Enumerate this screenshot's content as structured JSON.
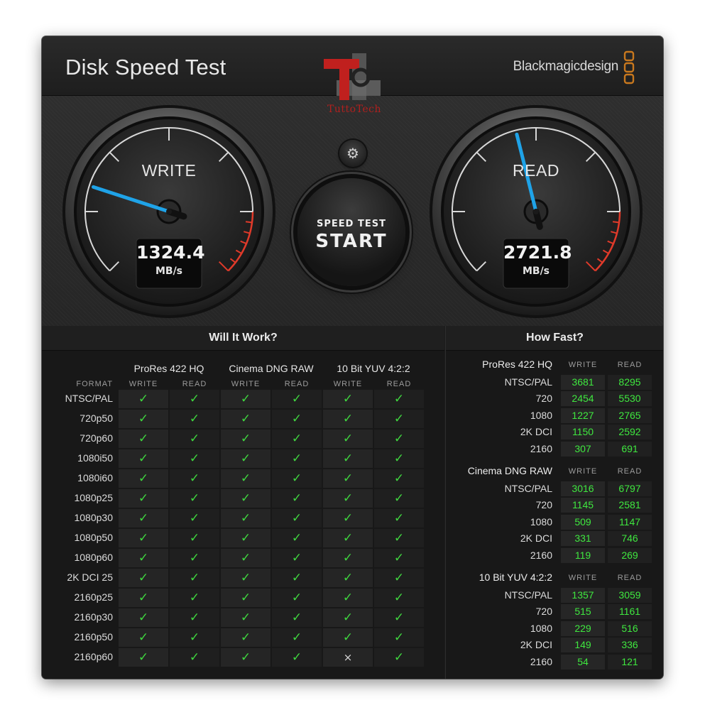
{
  "window": {
    "title": "Disk Speed Test",
    "brand": "Blackmagicdesign",
    "close_label": "×"
  },
  "watermark": {
    "text": "TuttoTech"
  },
  "gauges": {
    "write": {
      "label": "WRITE",
      "value": "1324.4",
      "unit": "MB/s"
    },
    "read": {
      "label": "READ",
      "value": "2721.8",
      "unit": "MB/s"
    }
  },
  "controls": {
    "settings_icon": "gear-icon",
    "settings_glyph": "⚙",
    "start_line1": "SPEED TEST",
    "start_line2": "START"
  },
  "will_it_work": {
    "title": "Will It Work?",
    "format_label": "FORMAT",
    "codecs": [
      {
        "name": "ProRes 422 HQ",
        "write": "WRITE",
        "read": "READ"
      },
      {
        "name": "Cinema DNG RAW",
        "write": "WRITE",
        "read": "READ"
      },
      {
        "name": "10 Bit YUV 4:2:2",
        "write": "WRITE",
        "read": "READ"
      }
    ],
    "formats": [
      "NTSC/PAL",
      "720p50",
      "720p60",
      "1080i50",
      "1080i60",
      "1080p25",
      "1080p30",
      "1080p50",
      "1080p60",
      "2K DCI 25",
      "2160p25",
      "2160p30",
      "2160p50",
      "2160p60"
    ],
    "results": [
      [
        1,
        1,
        1,
        1,
        1,
        1
      ],
      [
        1,
        1,
        1,
        1,
        1,
        1
      ],
      [
        1,
        1,
        1,
        1,
        1,
        1
      ],
      [
        1,
        1,
        1,
        1,
        1,
        1
      ],
      [
        1,
        1,
        1,
        1,
        1,
        1
      ],
      [
        1,
        1,
        1,
        1,
        1,
        1
      ],
      [
        1,
        1,
        1,
        1,
        1,
        1
      ],
      [
        1,
        1,
        1,
        1,
        1,
        1
      ],
      [
        1,
        1,
        1,
        1,
        1,
        1
      ],
      [
        1,
        1,
        1,
        1,
        1,
        1
      ],
      [
        1,
        1,
        1,
        1,
        1,
        1
      ],
      [
        1,
        1,
        1,
        1,
        1,
        1
      ],
      [
        1,
        1,
        1,
        1,
        1,
        1
      ],
      [
        1,
        1,
        1,
        1,
        0,
        1
      ]
    ],
    "ok_glyph": "✓",
    "fail_glyph": "×"
  },
  "how_fast": {
    "title": "How Fast?",
    "groups": [
      {
        "name": "ProRes 422 HQ",
        "write": "WRITE",
        "read": "READ",
        "rows": [
          {
            "format": "NTSC/PAL",
            "write": "3681",
            "read": "8295"
          },
          {
            "format": "720",
            "write": "2454",
            "read": "5530"
          },
          {
            "format": "1080",
            "write": "1227",
            "read": "2765"
          },
          {
            "format": "2K DCI",
            "write": "1150",
            "read": "2592"
          },
          {
            "format": "2160",
            "write": "307",
            "read": "691"
          }
        ]
      },
      {
        "name": "Cinema DNG RAW",
        "write": "WRITE",
        "read": "READ",
        "rows": [
          {
            "format": "NTSC/PAL",
            "write": "3016",
            "read": "6797"
          },
          {
            "format": "720",
            "write": "1145",
            "read": "2581"
          },
          {
            "format": "1080",
            "write": "509",
            "read": "1147"
          },
          {
            "format": "2K DCI",
            "write": "331",
            "read": "746"
          },
          {
            "format": "2160",
            "write": "119",
            "read": "269"
          }
        ]
      },
      {
        "name": "10 Bit YUV 4:2:2",
        "write": "WRITE",
        "read": "READ",
        "rows": [
          {
            "format": "NTSC/PAL",
            "write": "1357",
            "read": "3059"
          },
          {
            "format": "720",
            "write": "515",
            "read": "1161"
          },
          {
            "format": "1080",
            "write": "229",
            "read": "516"
          },
          {
            "format": "2K DCI",
            "write": "149",
            "read": "336"
          },
          {
            "format": "2160",
            "write": "54",
            "read": "121"
          }
        ]
      }
    ]
  },
  "colors": {
    "accent_green": "#3fd63f",
    "needle_blue": "#1fa3e8",
    "redline": "#e03a2a",
    "brand_orange": "#c8781e"
  }
}
